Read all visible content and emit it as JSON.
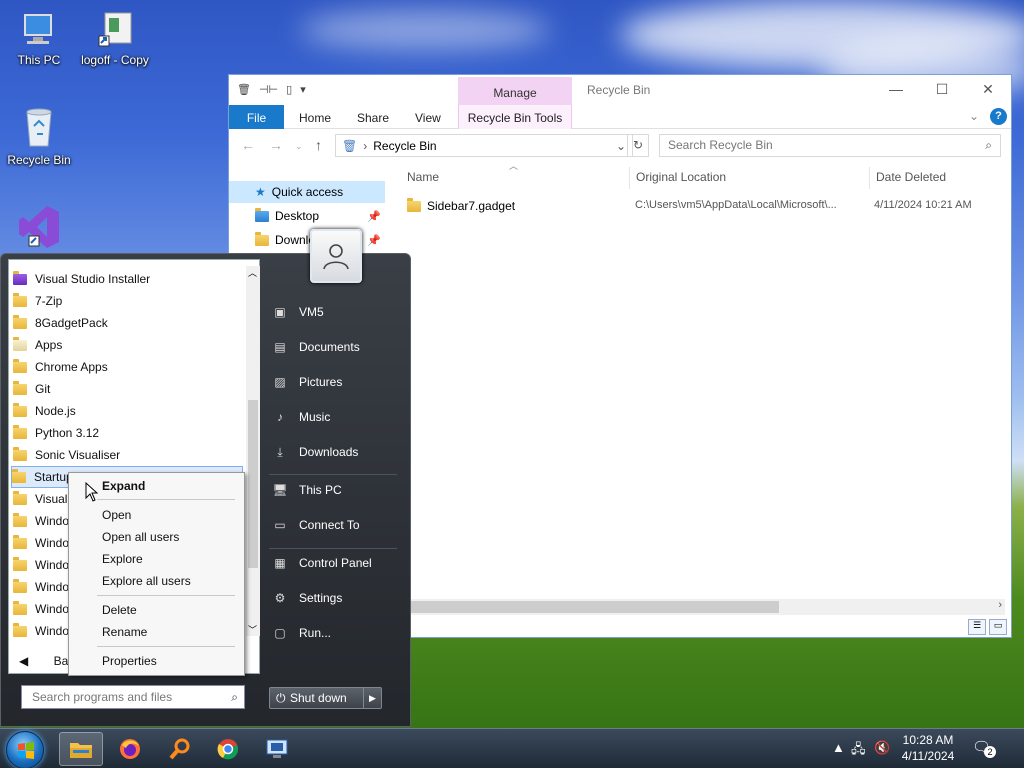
{
  "desktop": {
    "icons": [
      {
        "label": "This PC",
        "icon": "computer-icon"
      },
      {
        "label": "logoff - Copy",
        "icon": "shortcut-icon"
      },
      {
        "label": "Recycle Bin",
        "icon": "recycle-bin-icon"
      },
      {
        "label": "",
        "icon": "visual-studio-icon"
      }
    ]
  },
  "explorer": {
    "title": "Recycle Bin",
    "context_tab_header": "Manage",
    "tabs": [
      "File",
      "Home",
      "Share",
      "View",
      "Recycle Bin Tools"
    ],
    "address": "Recycle Bin",
    "search_placeholder": "Search Recycle Bin",
    "nav": [
      {
        "label": "Quick access",
        "selected": true
      },
      {
        "label": "Desktop",
        "pinned": true
      },
      {
        "label": "Downloads",
        "pinned": true
      }
    ],
    "columns": [
      "Name",
      "Original Location",
      "Date Deleted"
    ],
    "rows": [
      {
        "name": "Sidebar7.gadget",
        "location": "C:\\Users\\vm5\\AppData\\Local\\Microsoft\\...",
        "date": "4/11/2024 10:21 AM"
      }
    ],
    "hscroll_fraction": 0.62
  },
  "start_menu": {
    "programs": [
      "Visual Studio Installer",
      "7-Zip",
      "8GadgetPack",
      "Apps",
      "Chrome Apps",
      "Git",
      "Node.js",
      "Python 3.12",
      "Sonic Visualiser",
      "Startup",
      "Visual",
      "Windo",
      "Windo",
      "Windo",
      "Windo",
      "Windo",
      "Windo"
    ],
    "selected_program": "Startup",
    "back_label": "Back",
    "search_placeholder": "Search programs and files",
    "right_items": [
      "VM5",
      "Documents",
      "Pictures",
      "Music",
      "Downloads",
      "This PC",
      "Connect To",
      "Control Panel",
      "Settings",
      "Run..."
    ],
    "shutdown_label": "Shut down"
  },
  "context_menu": {
    "items": [
      "Expand",
      "Open",
      "Open all users",
      "Explore",
      "Explore all users",
      "Delete",
      "Rename",
      "Properties"
    ]
  },
  "taskbar": {
    "apps": [
      "file-explorer-icon",
      "firefox-icon",
      "search-magnifier-icon",
      "chrome-icon",
      "remote-desktop-icon"
    ],
    "time": "10:28 AM",
    "date": "4/11/2024",
    "notification_count": "2"
  }
}
